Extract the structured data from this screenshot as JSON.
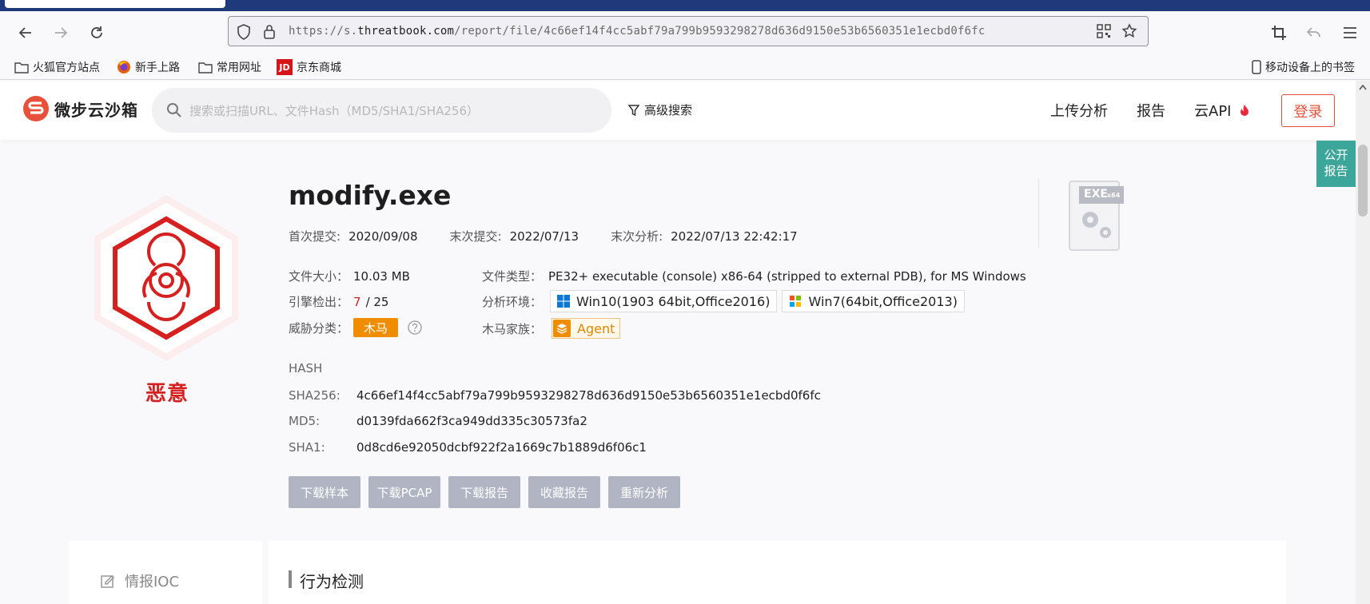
{
  "browser": {
    "url_prefix": "https://s.",
    "url_domain": "threatbook.com",
    "url_path": "/report/file/4c66ef14f4cc5abf79a799b9593298278d636d9150e53b6560351e1ecbd0f6fc",
    "icons": [
      "back-icon",
      "forward-icon",
      "reload-icon",
      "shield-icon",
      "lock-icon",
      "qr-code-icon",
      "star-icon",
      "crop-icon",
      "undo-icon",
      "menu-icon"
    ]
  },
  "bookmarks": {
    "items": [
      {
        "label": "火狐官方站点",
        "icon": "folder-icon"
      },
      {
        "label": "新手上路",
        "icon": "firefox-icon"
      },
      {
        "label": "常用网址",
        "icon": "folder-icon"
      },
      {
        "label": "京东商城",
        "icon": "jd-icon"
      }
    ],
    "mobile": "移动设备上的书签"
  },
  "site": {
    "logo_text": "微步云沙箱",
    "search_placeholder": "搜索或扫描URL、文件Hash（MD5/SHA1/SHA256）",
    "advanced_search": "高级搜索",
    "menu": [
      "上传分析",
      "报告",
      "云API"
    ],
    "login": "登录",
    "public_report": [
      "公开",
      "报告"
    ],
    "brand_color": "#e8503a"
  },
  "report": {
    "verdict": "恶意",
    "verdict_color": "#d6201f",
    "filename": "modify.exe",
    "first_submit_label": "首次提交:",
    "first_submit": "2020/09/08",
    "last_submit_label": "末次提交:",
    "last_submit": "2022/07/13",
    "last_analysis_label": "末次分析:",
    "last_analysis": "2022/07/13 22:42:17",
    "size_label": "文件大小：",
    "size": "10.03 MB",
    "type_label": "文件类型：",
    "type": "PE32+ executable (console) x86-64 (stripped to external PDB), for MS Windows",
    "engine_label": "引擎检出：",
    "engine_hits": "7",
    "engine_total": "/ 25",
    "env_label": "分析环境：",
    "envs": [
      "Win10(1903 64bit,Office2016)",
      "Win7(64bit,Office2013)"
    ],
    "threat_label": "威胁分类：",
    "threat": "木马",
    "family_label": "木马家族：",
    "family": "Agent",
    "file_badge": "EXE",
    "file_badge_sub": "x64",
    "hash_heading": "HASH",
    "sha256_label": "SHA256:",
    "sha256": "4c66ef14f4cc5abf79a799b9593298278d636d9150e53b6560351e1ecbd0f6fc",
    "md5_label": "MD5:",
    "md5": "d0139fda662f3ca949dd335c30573fa2",
    "sha1_label": "SHA1:",
    "sha1": "0d8cd6e92050dcbf922f2a1669c7b1889d6f06c1",
    "buttons": [
      "下载样本",
      "下载PCAP",
      "下载报告",
      "收藏报告",
      "重新分析"
    ]
  },
  "sections": {
    "ioc": "情报IOC",
    "behavior": "行为检测"
  }
}
